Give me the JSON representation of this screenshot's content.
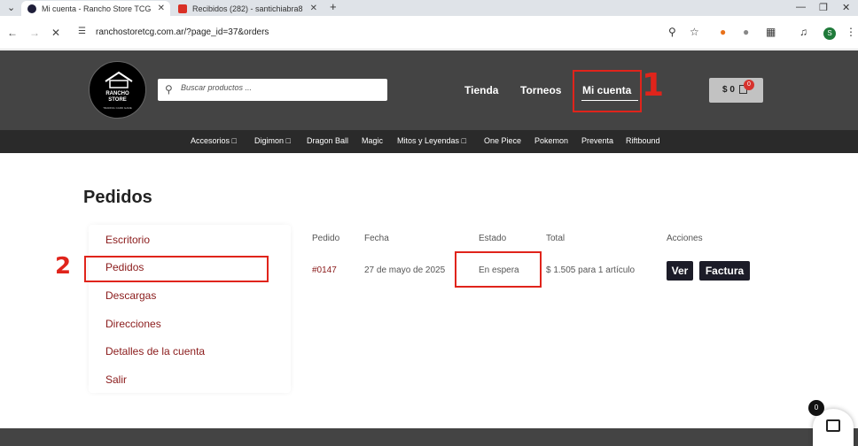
{
  "browser": {
    "tabs": [
      {
        "title": "Mi cuenta - Rancho Store TCG"
      },
      {
        "title": "Recibidos (282) - santichiabra8"
      }
    ],
    "url": "ranchostoretcg.com.ar/?page_id=37&orders",
    "profile_initial": "S"
  },
  "site": {
    "logo": {
      "line1": "RANCHO",
      "line2": "STORE",
      "line3": "TRADING CARD GAME"
    },
    "search_placeholder": "Buscar productos ...",
    "nav": [
      "Tienda",
      "Torneos",
      "Mi cuenta"
    ],
    "cart": {
      "amount": "$ 0",
      "count": "0"
    },
    "categories": [
      "Accesorios",
      "Digimon",
      "Dragon Ball",
      "Magic",
      "Mitos y Leyendas",
      "One Piece",
      "Pokemon",
      "Preventa",
      "Riftbound"
    ]
  },
  "page": {
    "title": "Pedidos",
    "account_menu": [
      "Escritorio",
      "Pedidos",
      "Descargas",
      "Direcciones",
      "Detalles de la cuenta",
      "Salir"
    ],
    "orders_table": {
      "headers": [
        "Pedido",
        "Fecha",
        "Estado",
        "Total",
        "Acciones"
      ],
      "rows": [
        {
          "number": "#0147",
          "date": "27 de mayo de 2025",
          "status": "En espera",
          "total": "$ 1.505 para 1 artículo",
          "actions": [
            "Ver",
            "Factura"
          ]
        }
      ]
    }
  },
  "annotations": {
    "marker_1": "1",
    "marker_2": "2"
  },
  "floating_cart": {
    "count": "0"
  },
  "colors": {
    "annotation_red": "#e0241b",
    "link_maroon": "#8a1a1a",
    "header_gray": "#444444",
    "button_dark": "#1c1c28"
  }
}
